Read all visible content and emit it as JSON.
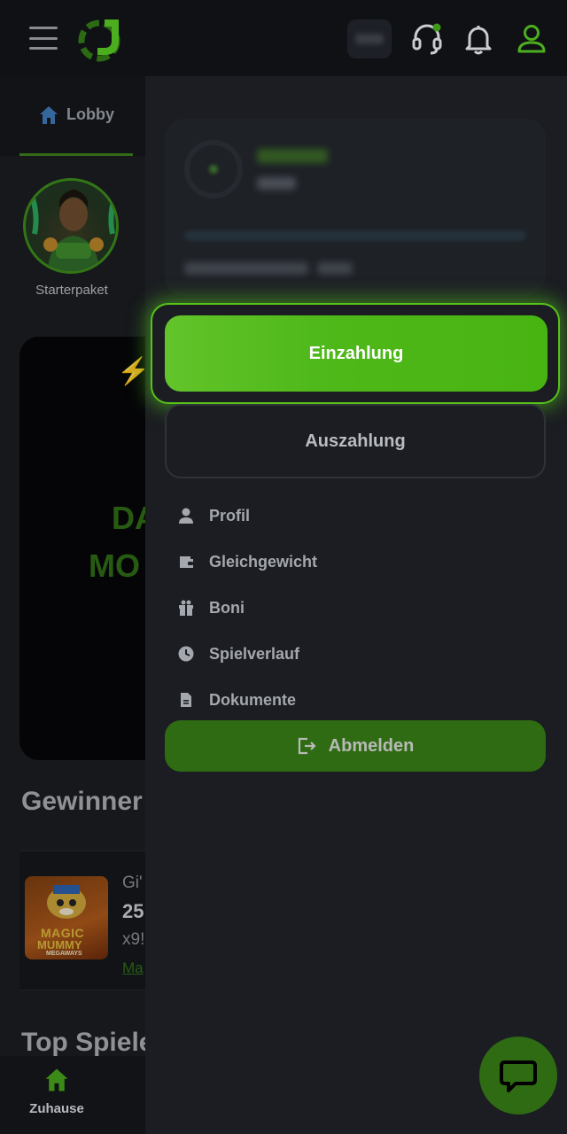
{
  "header": {
    "menu_icon": "hamburger-icon",
    "logo_icon": "brand-logo",
    "support_icon": "headset-icon",
    "notifications_icon": "bell-icon",
    "account_icon": "user-icon"
  },
  "tabs": {
    "lobby_label": "Lobby",
    "lobby_icon": "home-icon"
  },
  "starter": {
    "label": "Starterpaket"
  },
  "promo": {
    "line1": "DA",
    "line2": "MO",
    "icon": "lightning-icon"
  },
  "sections": {
    "winners_title": "Gewinner",
    "top_games_title": "Top Spiele"
  },
  "winner": {
    "game_image_line1": "MAGIC",
    "game_image_line2": "MUMMY",
    "game_image_line3": "MEGAWAYS",
    "player": "Gi'",
    "amount": "25",
    "multiplier": "x9!",
    "game_link": "Ma"
  },
  "drawer": {
    "deposit_label": "Einzahlung",
    "withdraw_label": "Auszahlung",
    "menu_items": [
      {
        "label": "Profil",
        "icon": "user-icon"
      },
      {
        "label": "Gleichgewicht",
        "icon": "wallet-icon"
      },
      {
        "label": "Boni",
        "icon": "gift-icon"
      },
      {
        "label": "Spielverlauf",
        "icon": "clock-icon"
      },
      {
        "label": "Dokumente",
        "icon": "document-icon"
      }
    ],
    "logout_label": "Abmelden",
    "logout_icon": "logout-icon"
  },
  "bottom_nav": {
    "home_label": "Zuhause",
    "home_icon": "home-icon"
  },
  "chat": {
    "icon": "chat-icon"
  },
  "colors": {
    "accent": "#4fb81a",
    "accent_dark": "#2f6b12",
    "background": "#1b1d22",
    "header": "#101114"
  }
}
